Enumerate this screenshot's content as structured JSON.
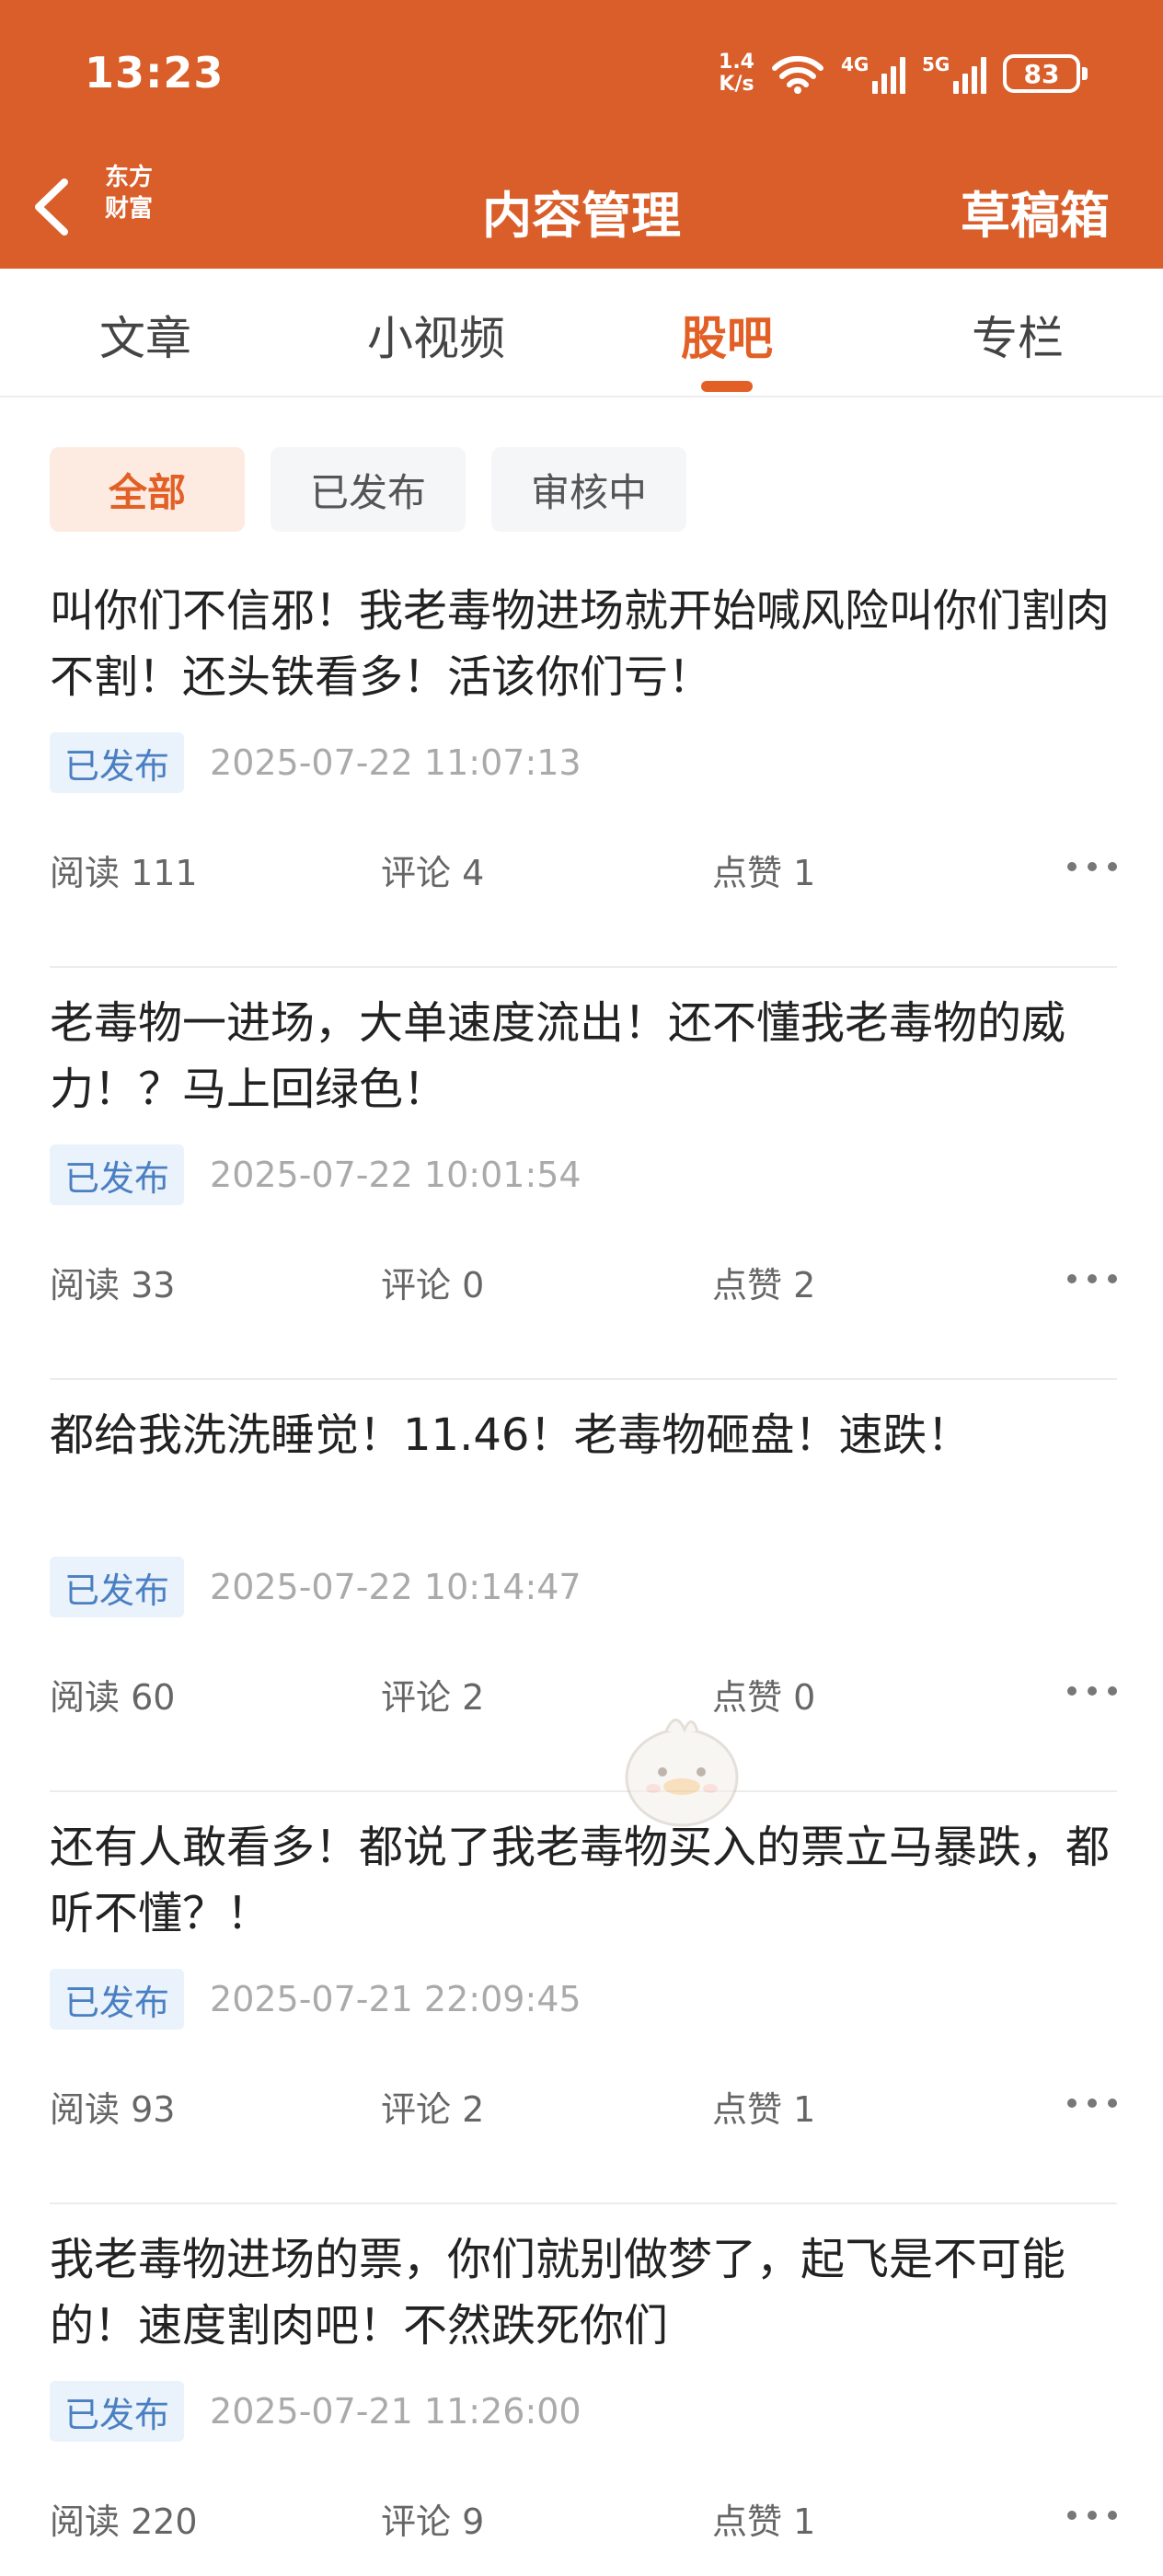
{
  "status_bar": {
    "time": "13:23",
    "net_speed_value": "1.4",
    "net_speed_unit": "K/s",
    "signal1_label": "4G",
    "signal2_label": "5G",
    "battery": "83"
  },
  "header": {
    "logo_line1": "东方",
    "logo_line2": "财富",
    "title": "内容管理",
    "drafts_label": "草稿箱"
  },
  "tabs": [
    {
      "label": "文章",
      "active": false
    },
    {
      "label": "小视频",
      "active": false
    },
    {
      "label": "股吧",
      "active": true
    },
    {
      "label": "专栏",
      "active": false
    }
  ],
  "filters": [
    {
      "label": "全部",
      "active": true
    },
    {
      "label": "已发布",
      "active": false
    },
    {
      "label": "审核中",
      "active": false
    }
  ],
  "posts": [
    {
      "text": "叫你们不信邪！我老毒物进场就开始喊风险叫你们割肉不割！还头铁看多！活该你们亏！",
      "status": "已发布",
      "date": "2025-07-22 11:07:13",
      "reads": "阅读 111",
      "comments": "评论 4",
      "likes": "点赞 1"
    },
    {
      "text": "老毒物一进场，大单速度流出！还不懂我老毒物的威力！？马上回绿色！",
      "status": "已发布",
      "date": "2025-07-22 10:01:54",
      "reads": "阅读 33",
      "comments": "评论 0",
      "likes": "点赞 2"
    },
    {
      "text": "都给我洗洗睡觉！11.46！老毒物砸盘！速跌！",
      "status": "已发布",
      "date": "2025-07-22 10:14:47",
      "reads": "阅读 60",
      "comments": "评论 2",
      "likes": "点赞 0"
    },
    {
      "text": "还有人敢看多！都说了我老毒物买入的票立马暴跌，都听不懂？！",
      "status": "已发布",
      "date": "2025-07-21 22:09:45",
      "reads": "阅读 93",
      "comments": "评论 2",
      "likes": "点赞 1"
    },
    {
      "text": "我老毒物进场的票，你们就别做梦了，起飞是不可能的！速度割肉吧！不然跌死你们",
      "status": "已发布",
      "date": "2025-07-21 11:26:00",
      "reads": "阅读 220",
      "comments": "评论 9",
      "likes": "点赞 1"
    }
  ],
  "icons": {
    "back": "chevron-left-icon",
    "wifi": "wifi-icon",
    "more": "more-dots-icon",
    "mascot": "mascot-icon"
  },
  "colors": {
    "brand": "#d95e2a",
    "accent": "#e25f25",
    "badge_bg": "#eaf2fb",
    "badge_text": "#4a7fc1"
  }
}
